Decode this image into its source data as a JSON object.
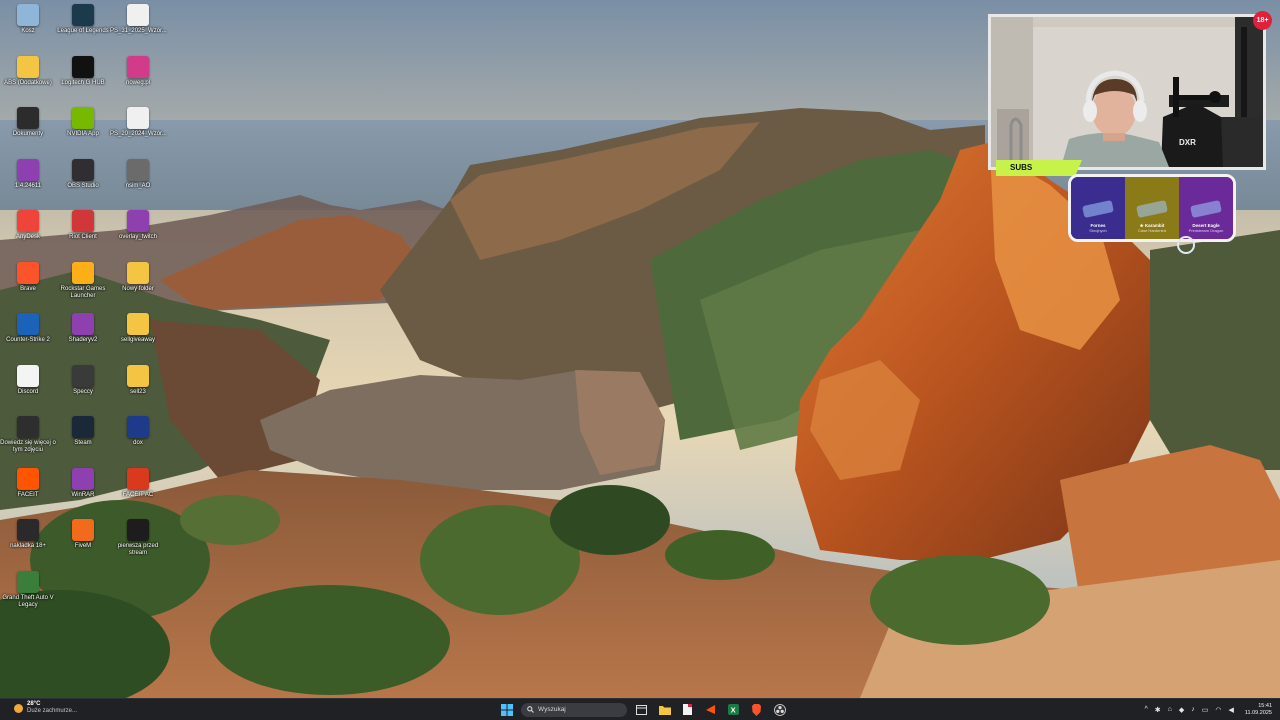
{
  "desktop_icons": [
    {
      "label": "Kosz",
      "icon": "recycle-bin-icon",
      "color": "#8fb5d9"
    },
    {
      "label": "League of Legends",
      "icon": "league-of-legends-icon",
      "color": "#1b3a4b"
    },
    {
      "label": "PS_31_2025_Wzór...",
      "icon": "pdf-file-icon",
      "color": "#f0f0f0"
    },
    {
      "label": "ABS (Dodatkowe)",
      "icon": "folder-icon",
      "color": "#f4c542"
    },
    {
      "label": "Logitech G HUB",
      "icon": "logitech-g-hub-icon",
      "color": "#111111"
    },
    {
      "label": "noweg.pl",
      "icon": "winrar-archive-icon",
      "color": "#d23a8a"
    },
    {
      "label": "Dokumenty",
      "icon": "folder-dark-icon",
      "color": "#2c2c2c"
    },
    {
      "label": "NVIDIA App",
      "icon": "nvidia-icon",
      "color": "#76b900"
    },
    {
      "label": "PS_20_2024_Wzór...",
      "icon": "pdf-file-icon",
      "color": "#f0f0f0"
    },
    {
      "label": "1.4.24611",
      "icon": "winrar-archive-icon",
      "color": "#8e3fb0"
    },
    {
      "label": "OBS Studio",
      "icon": "obs-studio-icon",
      "color": "#302e31"
    },
    {
      "label": "nsim_AO",
      "icon": "film-file-icon",
      "color": "#6b6b6b"
    },
    {
      "label": "AnyDesk",
      "icon": "anydesk-icon",
      "color": "#ef443b"
    },
    {
      "label": "Riot Client",
      "icon": "riot-client-icon",
      "color": "#d13639"
    },
    {
      "label": "overlay_twitch",
      "icon": "winrar-archive-icon",
      "color": "#8e3fb0"
    },
    {
      "label": "Brave",
      "icon": "brave-browser-icon",
      "color": "#fb542b"
    },
    {
      "label": "Rockstar Games Launcher",
      "icon": "rockstar-games-icon",
      "color": "#fcaf17"
    },
    {
      "label": "Nowy folder",
      "icon": "folder-icon",
      "color": "#f4c542"
    },
    {
      "label": "Counter-Strike 2",
      "icon": "counter-strike-2-icon",
      "color": "#1b63b8"
    },
    {
      "label": "Shaderyv2",
      "icon": "winrar-archive-icon",
      "color": "#8e3fb0"
    },
    {
      "label": "sellgiveaway",
      "icon": "folder-icon",
      "color": "#f4c542"
    },
    {
      "label": "Discord",
      "icon": "text-file-icon",
      "color": "#f4f4f4"
    },
    {
      "label": "Speccy",
      "icon": "speccy-icon",
      "color": "#3a3a3a"
    },
    {
      "label": "sell23",
      "icon": "folder-icon",
      "color": "#f4c542"
    },
    {
      "label": "Dowiedz się więcej o tym zdjęciu",
      "icon": "camera-info-icon",
      "color": "#2e2e2e"
    },
    {
      "label": "Steam",
      "icon": "steam-icon",
      "color": "#1b2838"
    },
    {
      "label": "dox",
      "icon": "media-file-icon",
      "color": "#1e3a8a"
    },
    {
      "label": "FACEIT",
      "icon": "faceit-icon",
      "color": "#ff5500"
    },
    {
      "label": "WinRAR",
      "icon": "winrar-icon",
      "color": "#8e3fb0"
    },
    {
      "label": "FACEIT AC",
      "icon": "faceit-ac-icon",
      "color": "#d93a1e"
    },
    {
      "label": "nakladka 18+",
      "icon": "blank-file-icon",
      "color": "#2a2a2a"
    },
    {
      "label": "FiveM",
      "icon": "fivem-icon",
      "color": "#f26a1b"
    },
    {
      "label": "pierwsza przed stream",
      "icon": "blank-file-icon",
      "color": "#1d1d1d"
    },
    {
      "label": "Grand Theft Auto V Legacy",
      "icon": "gta-v-icon",
      "color": "#3b7d3b"
    }
  ],
  "webcam": {
    "live_badge": "18+",
    "subs_label": "SUBS"
  },
  "case_widget": {
    "items": [
      {
        "name": "Fornes",
        "sub": "Skrojnych",
        "color": "#3b2d8f"
      },
      {
        "name": "★ Karambit",
        "sub": "Case Hardened",
        "color": "#8a7a18"
      },
      {
        "name": "Desert Eagle",
        "sub": "Printstream Dragon",
        "color": "#6a2a9a"
      }
    ]
  },
  "taskbar": {
    "weather": {
      "temp": "28°C",
      "desc": "Duże zachmurze..."
    },
    "search_placeholder": "Wyszukaj",
    "clock": {
      "time": "15:41",
      "date": "11.09.2025"
    },
    "apps": [
      "file-explorer-icon",
      "taskview-icon",
      "notepad-icon",
      "faceit-taskbar-icon",
      "excel-icon",
      "brave-taskbar-icon",
      "obs-taskbar-icon"
    ]
  },
  "colors": {
    "taskbar_bg": "#1f2124",
    "accent_subs": "#c7f24a",
    "live_badge": "#e0213a"
  }
}
